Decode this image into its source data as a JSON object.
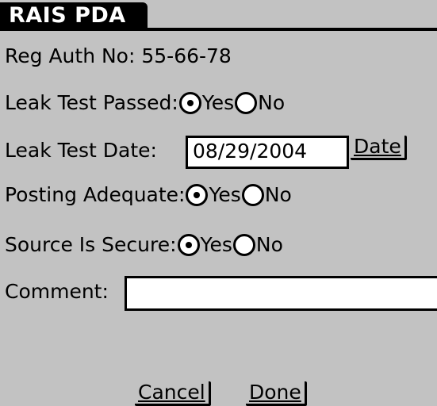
{
  "app": {
    "title": "RAIS PDA"
  },
  "reg_auth": {
    "label": "Reg Auth No:",
    "value": "55-66-78"
  },
  "leak_test_passed": {
    "label": "Leak Test Passed:",
    "yes": "Yes",
    "no": "No",
    "selected": "Yes"
  },
  "leak_test_date": {
    "label": "Leak Test Date:",
    "value": "08/29/2004",
    "button": "Date"
  },
  "posting_adequate": {
    "label": "Posting Adequate:",
    "yes": "Yes",
    "no": "No",
    "selected": "Yes"
  },
  "source_secure": {
    "label": "Source Is Secure:",
    "yes": "Yes",
    "no": "No",
    "selected": "Yes"
  },
  "comment": {
    "label": "Comment:",
    "value": ""
  },
  "buttons": {
    "cancel": "Cancel",
    "done": "Done"
  }
}
